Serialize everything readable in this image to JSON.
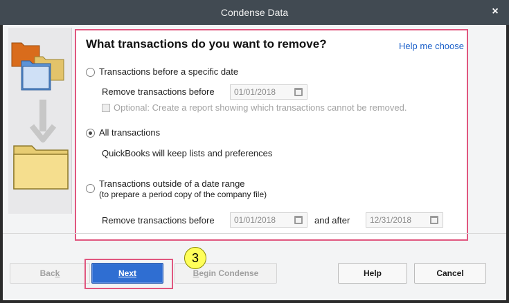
{
  "window": {
    "title": "Condense Data",
    "close_label": "×"
  },
  "main": {
    "heading": "What transactions do you want to remove?",
    "help_link": "Help me choose",
    "option1": {
      "label": "Transactions before a specific date",
      "sub_label": "Remove transactions before",
      "date_value": "01/01/2018",
      "optional_text": "Optional: Create a report showing which transactions cannot be removed."
    },
    "option2": {
      "label": "All transactions",
      "note": "QuickBooks will keep lists and preferences"
    },
    "option3": {
      "label": "Transactions outside of a date range",
      "sub_label": "(to prepare a period copy of the company file)",
      "range_label": "Remove transactions before",
      "before_value": "01/01/2018",
      "after_label": "and after",
      "after_value": "12/31/2018"
    }
  },
  "footer": {
    "back_label_pre": "Bac",
    "back_label_key": "k",
    "next_label": "Next",
    "begin_label_key": "B",
    "begin_label_rest": "egin Condense",
    "help_label": "Help",
    "cancel_label": "Cancel"
  },
  "annotation": {
    "step_number": "3",
    "color": "#e0577f",
    "badge_color": "#ffff5a"
  },
  "icons": {
    "folder_stack": "folder-stack-icon",
    "arrow_down": "arrow-down-icon",
    "folder": "folder-icon",
    "calendar": "calendar-icon"
  }
}
